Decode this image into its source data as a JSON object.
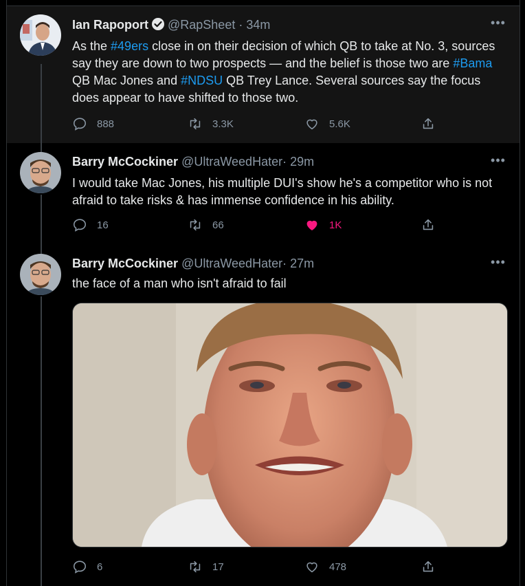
{
  "tweets": [
    {
      "name": "Ian Rapoport",
      "handle": "@RapSheet",
      "time": "· 34m",
      "verified": true,
      "text_parts": [
        "As the ",
        "#49ers",
        " close in on their decision of which QB to take at No. 3, sources say they are down to two prospects — and the belief is those two are ",
        "#Bama",
        " QB Mac Jones and ",
        "#NDSU",
        " QB Trey Lance. Several sources say the focus does appear to have shifted to those two."
      ],
      "replies": "888",
      "retweets": "3.3K",
      "likes": "5.6K"
    },
    {
      "name": "Barry McCockiner",
      "handle": "@UltraWeedHater",
      "time": "· 29m",
      "text": "I would take Mac Jones, his multiple DUI's show he's a competitor who is not afraid to take risks & has immense confidence in his ability.",
      "replies": "16",
      "retweets": "66",
      "likes": "1K",
      "liked": true
    },
    {
      "name": "Barry McCockiner",
      "handle": "@UltraWeedHater",
      "time": "· 27m",
      "text": "the face of a man who isn't afraid to fail",
      "replies": "6",
      "retweets": "17",
      "likes": "478"
    }
  ],
  "colors": {
    "background": "#000000",
    "highlight_row": "#141414",
    "link": "#1d9bf0",
    "like": "#f91880",
    "muted": "#8b98a5"
  },
  "icons": [
    "reply-icon",
    "retweet-icon",
    "like-icon",
    "share-icon",
    "more-icon",
    "verified-badge-icon"
  ]
}
